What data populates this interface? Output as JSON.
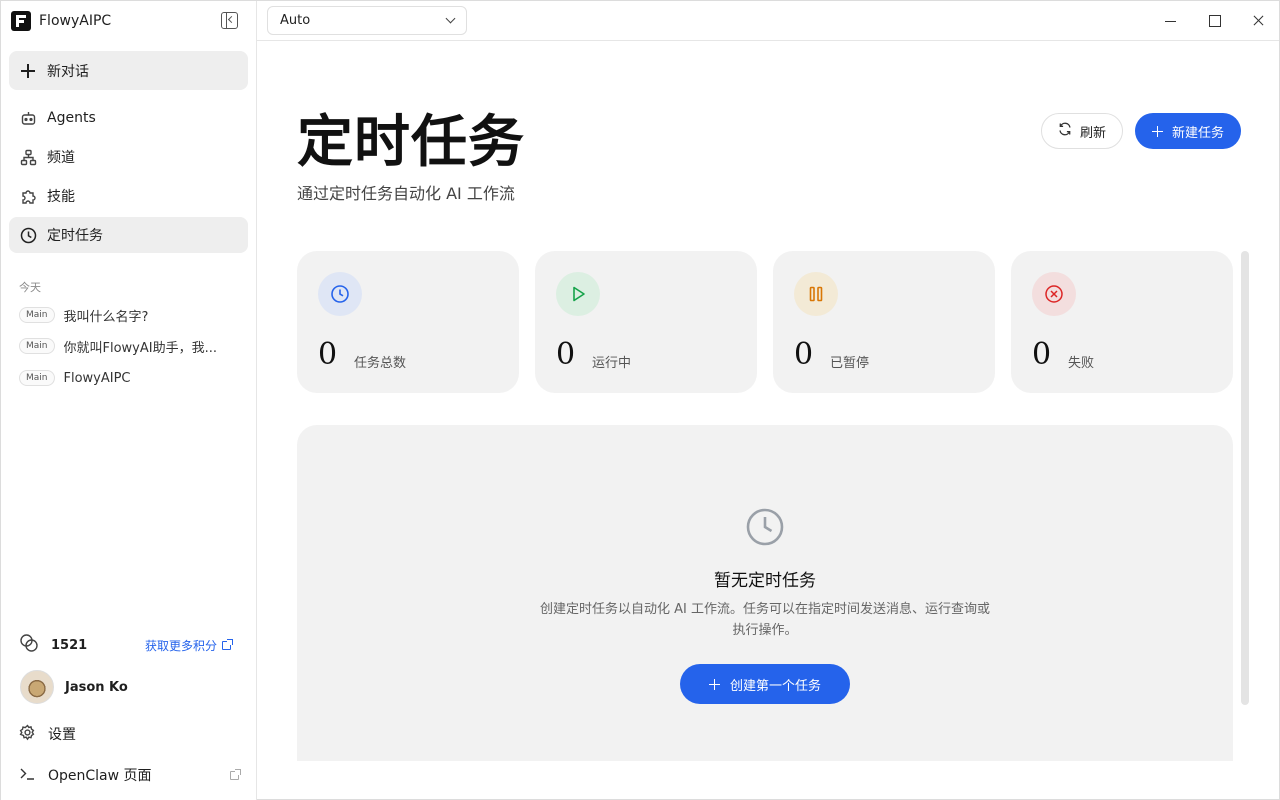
{
  "app": {
    "name": "FlowyAIPC"
  },
  "sidebar": {
    "new_chat": "新对话",
    "nav": [
      {
        "label": "Agents",
        "icon": "bot-icon"
      },
      {
        "label": "频道",
        "icon": "channel-icon"
      },
      {
        "label": "技能",
        "icon": "puzzle-icon"
      },
      {
        "label": "定时任务",
        "icon": "clock-icon",
        "active": true
      }
    ],
    "history_section": "今天",
    "history": [
      {
        "tag": "Main",
        "text": "我叫什么名字?"
      },
      {
        "tag": "Main",
        "text": "你就叫FlowyAI助手，我..."
      },
      {
        "tag": "Main",
        "text": "FlowyAIPC"
      }
    ],
    "credits": {
      "value": "1521",
      "link": "获取更多积分"
    },
    "user": {
      "name": "Jason Ko"
    },
    "settings": "设置",
    "openclaw": "OpenClaw 页面"
  },
  "topbar": {
    "model": "Auto"
  },
  "main": {
    "title": "定时任务",
    "subtitle": "通过定时任务自动化 AI 工作流",
    "refresh": "刷新",
    "new_task": "新建任务",
    "stats": [
      {
        "value": "0",
        "label": "任务总数",
        "icon": "clock-icon",
        "color": "#2563eb",
        "bg": "#dfe6f5"
      },
      {
        "value": "0",
        "label": "运行中",
        "icon": "play-icon",
        "color": "#16a34a",
        "bg": "#dcefe2"
      },
      {
        "value": "0",
        "label": "已暂停",
        "icon": "pause-icon",
        "color": "#d97706",
        "bg": "#f3ead6"
      },
      {
        "value": "0",
        "label": "失败",
        "icon": "x-circle-icon",
        "color": "#dc2626",
        "bg": "#f3dede"
      }
    ],
    "empty": {
      "title": "暂无定时任务",
      "desc": "创建定时任务以自动化 AI 工作流。任务可以在指定时间发送消息、运行查询或执行操作。",
      "cta": "创建第一个任务"
    }
  }
}
